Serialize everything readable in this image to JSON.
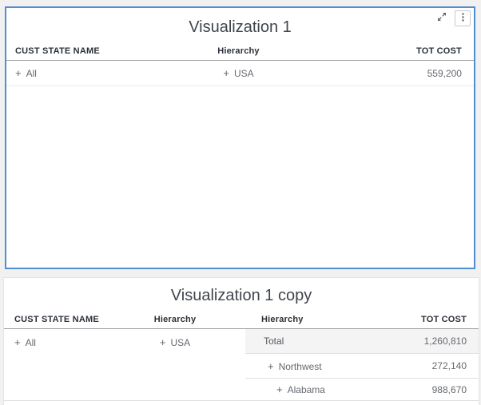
{
  "colors": {
    "page_bg": "#f1f1f2",
    "selected_panel_border": "#4f8fd0",
    "shaded_row_bg": "#f4f4f5"
  },
  "top_panel": {
    "title": "Visualization 1",
    "toolbar": {
      "expand_icon": "diagonal-expand-arrows",
      "menu_icon": "vertical-three-dots"
    },
    "headers": {
      "col1": "CUST STATE NAME",
      "col2": "Hierarchy",
      "col3": "TOT COST"
    },
    "row": {
      "state_expand": "+",
      "state": "All",
      "hierarchy_expand": "+",
      "hierarchy": "USA",
      "tot_cost": "559,200"
    }
  },
  "bottom_panel": {
    "title": "Visualization 1 copy",
    "headers": {
      "col1": "CUST STATE NAME",
      "col2": "Hierarchy",
      "col3": "Hierarchy",
      "col4": "TOT COST"
    },
    "group_row": {
      "state_expand": "+",
      "state": "All",
      "hierarchy_expand": "+",
      "hierarchy": "USA"
    },
    "sub_rows": [
      {
        "label": "Total",
        "value": "1,260,810"
      },
      {
        "expand": "+",
        "label": "Northwest",
        "value": "272,140"
      },
      {
        "expand": "+",
        "label": "Alabama",
        "value": "988,670"
      }
    ]
  }
}
